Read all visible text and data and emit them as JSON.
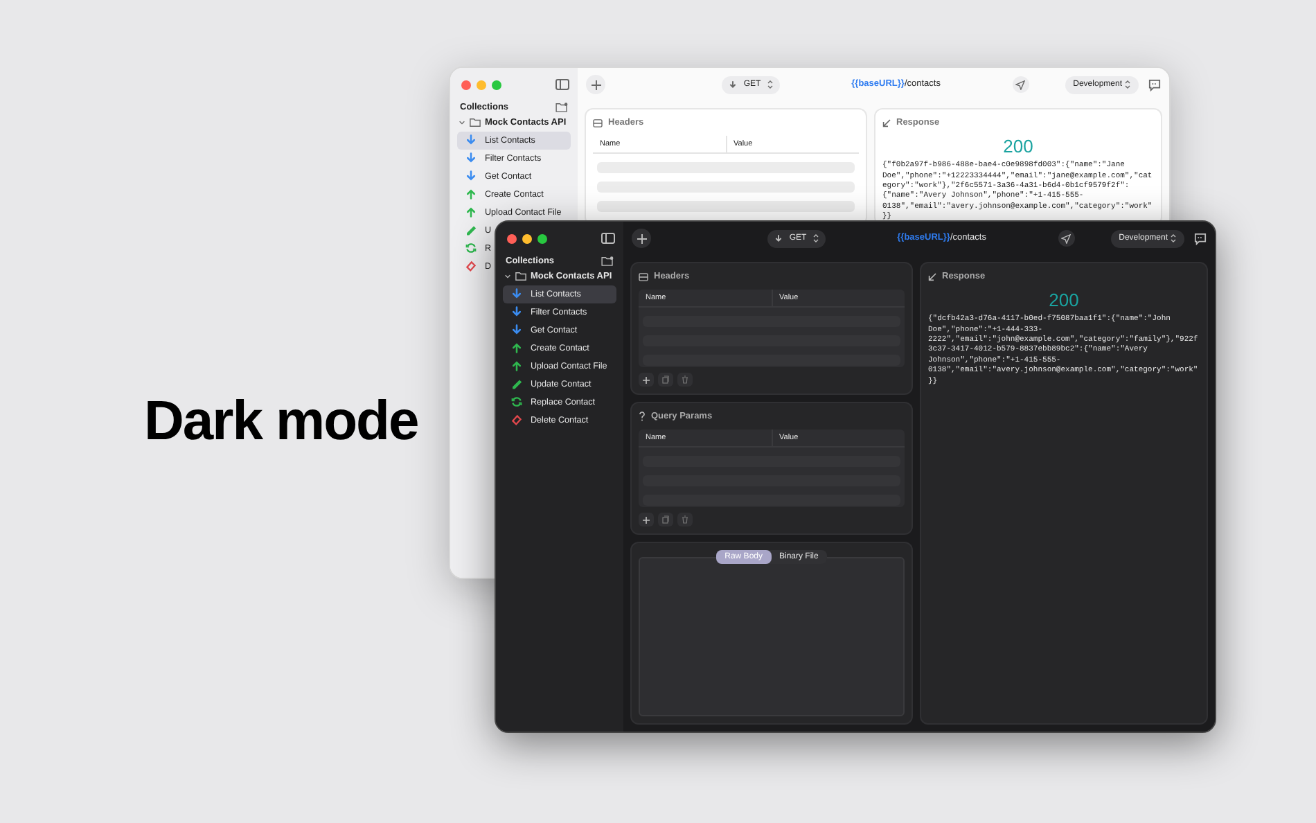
{
  "headline": "Dark mode",
  "windows": [
    {
      "kind": "light",
      "method": "GET",
      "url_variable": "{{baseURL}}",
      "url_path": "/contacts",
      "environment": "Development",
      "sidebar": {
        "title": "Collections",
        "collection": {
          "name": "Mock Contacts API",
          "expanded": true,
          "children": [
            {
              "name": "List Contacts",
              "kind": "download",
              "selected": true
            },
            {
              "name": "Filter Contacts",
              "kind": "download",
              "selected": false
            },
            {
              "name": "Get Contact",
              "kind": "download",
              "selected": false
            },
            {
              "name": "Create Contact",
              "kind": "upload",
              "selected": false
            },
            {
              "name": "Upload Contact File",
              "kind": "upload",
              "selected": false
            },
            {
              "name": "U",
              "kind": "edit",
              "selected": false
            },
            {
              "name": "R",
              "kind": "replace",
              "selected": false
            },
            {
              "name": "D",
              "kind": "delete",
              "selected": false
            }
          ]
        }
      },
      "panels": [
        {
          "kind": "table",
          "title": "Headers",
          "columns": [
            "Name",
            "Value"
          ]
        }
      ],
      "response": {
        "title": "Response",
        "status": "200",
        "body": "{\"f0b2a97f-b986-488e-bae4-c0e9898fd003\":{\"name\":\"Jane Doe\",\"phone\":\"+12223334444\",\"email\":\"jane@example.com\",\"category\":\"work\"},\"2f6c5571-3a36-4a31-b6d4-0b1cf9579f2f\":{\"name\":\"Avery Johnson\",\"phone\":\"+1-415-555-0138\",\"email\":\"avery.johnson@example.com\",\"category\":\"work\"}}"
      }
    },
    {
      "kind": "dark",
      "method": "GET",
      "url_variable": "{{baseURL}}",
      "url_path": "/contacts",
      "environment": "Development",
      "sidebar": {
        "title": "Collections",
        "collection": {
          "name": "Mock Contacts API",
          "expanded": true,
          "children": [
            {
              "name": "List Contacts",
              "kind": "download",
              "selected": true
            },
            {
              "name": "Filter Contacts",
              "kind": "download",
              "selected": false
            },
            {
              "name": "Get Contact",
              "kind": "download",
              "selected": false
            },
            {
              "name": "Create Contact",
              "kind": "upload",
              "selected": false
            },
            {
              "name": "Upload Contact File",
              "kind": "upload",
              "selected": false
            },
            {
              "name": "Update Contact",
              "kind": "edit",
              "selected": false
            },
            {
              "name": "Replace Contact",
              "kind": "replace",
              "selected": false
            },
            {
              "name": "Delete Contact",
              "kind": "delete",
              "selected": false
            }
          ]
        }
      },
      "panels": [
        {
          "kind": "table",
          "title": "Headers",
          "columns": [
            "Name",
            "Value"
          ]
        },
        {
          "kind": "table",
          "title": "Query Params",
          "columns": [
            "Name",
            "Value"
          ]
        },
        {
          "kind": "body",
          "tabs": [
            {
              "label": "Raw Body",
              "selected": true
            },
            {
              "label": "Binary File",
              "selected": false
            }
          ]
        }
      ],
      "response": {
        "title": "Response",
        "status": "200",
        "body": "{\"dcfb42a3-d76a-4117-b0ed-f75087baa1f1\":{\"name\":\"John Doe\",\"phone\":\"+1-444-333-2222\",\"email\":\"john@example.com\",\"category\":\"family\"},\"922f3c37-3417-4012-b579-8837ebb89bc2\":{\"name\":\"Avery Johnson\",\"phone\":\"+1-415-555-0138\",\"email\":\"avery.johnson@example.com\",\"category\":\"work\"}}"
      }
    }
  ]
}
